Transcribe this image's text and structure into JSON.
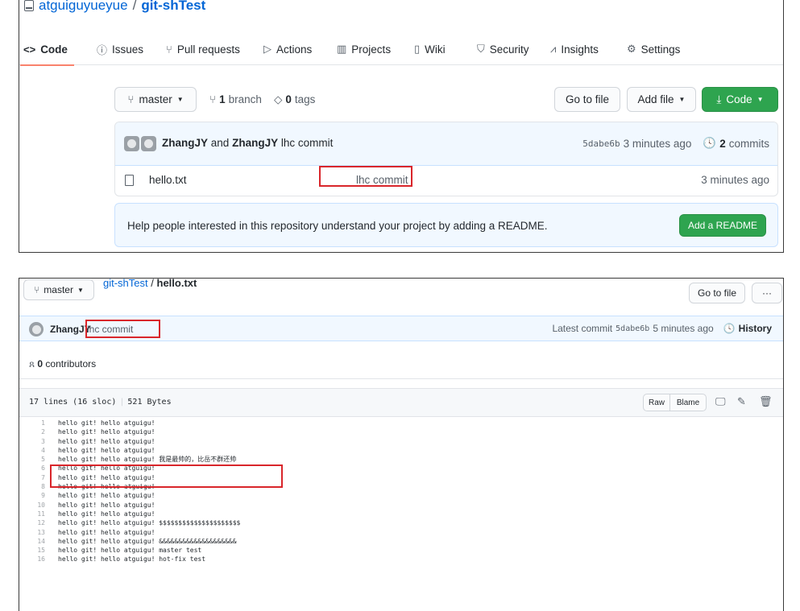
{
  "repo": {
    "owner": "atguiguyueyue",
    "separator": "/",
    "name": "git-shTest"
  },
  "tabs": [
    {
      "label": "Code",
      "icon": "code-icon",
      "glyph": "<>",
      "selected": true
    },
    {
      "label": "Issues",
      "icon": "issue-icon",
      "glyph": "ⓘ"
    },
    {
      "label": "Pull requests",
      "icon": "pull-request-icon",
      "glyph": "⑂"
    },
    {
      "label": "Actions",
      "icon": "play-icon",
      "glyph": "▷"
    },
    {
      "label": "Projects",
      "icon": "project-icon",
      "glyph": "▥"
    },
    {
      "label": "Wiki",
      "icon": "book-icon",
      "glyph": "▯"
    },
    {
      "label": "Security",
      "icon": "shield-icon",
      "glyph": "⛉"
    },
    {
      "label": "Insights",
      "icon": "graph-icon",
      "glyph": "⩘"
    },
    {
      "label": "Settings",
      "icon": "gear-icon",
      "glyph": "⚙"
    }
  ],
  "toolbar": {
    "branch": "master",
    "branch_count": "1",
    "branch_label": "branch",
    "tag_count": "0",
    "tag_label": "tags",
    "go_to_file": "Go to file",
    "add_file": "Add file",
    "code": "Code"
  },
  "latest_commit": {
    "author1": "ZhangJY",
    "and": "and",
    "author2": "ZhangJY",
    "message": "lhc commit",
    "sha": "5dabe6b",
    "age": "3 minutes ago",
    "commits_count": "2",
    "commits_label": "commits"
  },
  "files": [
    {
      "name": "hello.txt",
      "message": "lhc commit",
      "age": "3 minutes ago"
    }
  ],
  "readme": {
    "text": "Help people interested in this repository understand your project by adding a README.",
    "button": "Add a README"
  },
  "file_view": {
    "branch": "master",
    "repo": "git-shTest",
    "separator": "/",
    "file": "hello.txt",
    "go_to_file": "Go to file",
    "more": "···",
    "commit_author": "ZhangJY",
    "commit_message": "lhc commit",
    "latest_label": "Latest commit",
    "sha": "5dabe6b",
    "age": "5 minutes ago",
    "history": "History",
    "contributors_count": "0",
    "contributors_label": "contributors",
    "lines_info": "17 lines (16 sloc)",
    "size": "521 Bytes",
    "raw": "Raw",
    "blame": "Blame"
  },
  "code_lines": [
    {
      "n": "1",
      "text": "hello git! hello atguigu!"
    },
    {
      "n": "2",
      "text": "hello git! hello atguigu!"
    },
    {
      "n": "3",
      "text": "hello git! hello atguigu!"
    },
    {
      "n": "4",
      "text": "hello git! hello atguigu!"
    },
    {
      "n": "5",
      "text": "hello git! hello atguigu! 我是最帅的，比岳不群还帅"
    },
    {
      "n": "6",
      "text": "hello git! hello atguigu!"
    },
    {
      "n": "7",
      "text": "hello git! hello atguigu!"
    },
    {
      "n": "8",
      "text": "hello git! hello atguigu!"
    },
    {
      "n": "9",
      "text": "hello git! hello atguigu!"
    },
    {
      "n": "10",
      "text": "hello git! hello atguigu!"
    },
    {
      "n": "11",
      "text": "hello git! hello atguigu!"
    },
    {
      "n": "12",
      "text": "hello git! hello atguigu! $$$$$$$$$$$$$$$$$$$$$"
    },
    {
      "n": "13",
      "text": "hello git! hello atguigu!"
    },
    {
      "n": "14",
      "text": "hello git! hello atguigu! &&&&&&&&&&&&&&&&&&&&"
    },
    {
      "n": "15",
      "text": "hello git! hello atguigu! master test"
    },
    {
      "n": "16",
      "text": "hello git! hello atguigu! hot-fix test"
    }
  ]
}
